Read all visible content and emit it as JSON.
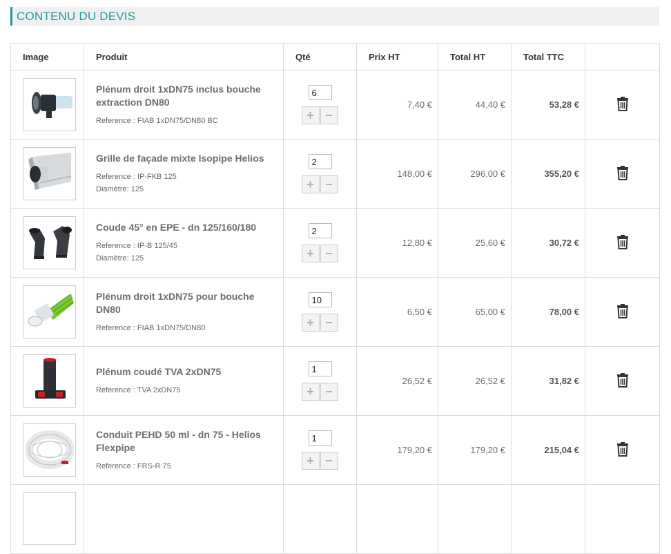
{
  "section": {
    "title": "CONTENU DU DEVIS"
  },
  "table": {
    "headers": {
      "image": "Image",
      "product": "Produit",
      "qty": "Qté",
      "unit_price": "Prix HT",
      "total_ht": "Total HT",
      "total_ttc": "Total TTC"
    }
  },
  "rows": [
    {
      "name": "Plénum droit 1xDN75 inclus bouche extraction DN80",
      "reference": "Reference : FIAB 1xDN75/DN80 BC",
      "diameter": "",
      "qty": "6",
      "unit_price": "7,40 €",
      "total_ht": "44,40 €",
      "total_ttc": "53,28 €",
      "image_icon": "plenum-icon"
    },
    {
      "name": "Grille de façade mixte Isopipe Helios",
      "reference": "Reference : IP-FKB 125",
      "diameter": "Diamètre: 125",
      "qty": "2",
      "unit_price": "148,00 €",
      "total_ht": "296,00 €",
      "total_ttc": "355,20 €",
      "image_icon": "facade-grille-icon"
    },
    {
      "name": "Coude 45° en EPE - dn 125/160/180",
      "reference": "Reference : IP-B 125/45",
      "diameter": "Diamètre: 125",
      "qty": "2",
      "unit_price": "12,80 €",
      "total_ht": "25,60 €",
      "total_ttc": "30,72 €",
      "image_icon": "elbow-icon"
    },
    {
      "name": "Plénum droit 1xDN75 pour bouche DN80",
      "reference": "Reference : FIAB 1xDN75/DN80",
      "diameter": "",
      "qty": "10",
      "unit_price": "6,50 €",
      "total_ht": "65,00 €",
      "total_ttc": "78,00 €",
      "image_icon": "plenum-hose-icon"
    },
    {
      "name": "Plénum coudé TVA 2xDN75",
      "reference": "Reference : TVA 2xDN75",
      "diameter": "",
      "qty": "1",
      "unit_price": "26,52 €",
      "total_ht": "26,52 €",
      "total_ttc": "31,82 €",
      "image_icon": "plenum-elbow-icon"
    },
    {
      "name": "Conduit PEHD 50 ml - dn 75 - Helios Flexpipe",
      "reference": "Reference : FRS-R 75",
      "diameter": "",
      "qty": "1",
      "unit_price": "179,20 €",
      "total_ht": "179,20 €",
      "total_ttc": "215,04 €",
      "image_icon": "pipe-coil-icon"
    }
  ],
  "icons": {
    "plus": "plus-icon",
    "minus": "minus-icon",
    "delete": "trash-icon"
  },
  "colors": {
    "accent": "#1a9a98",
    "border": "#dcdcdc",
    "title_bg": "#f0f0f0"
  }
}
